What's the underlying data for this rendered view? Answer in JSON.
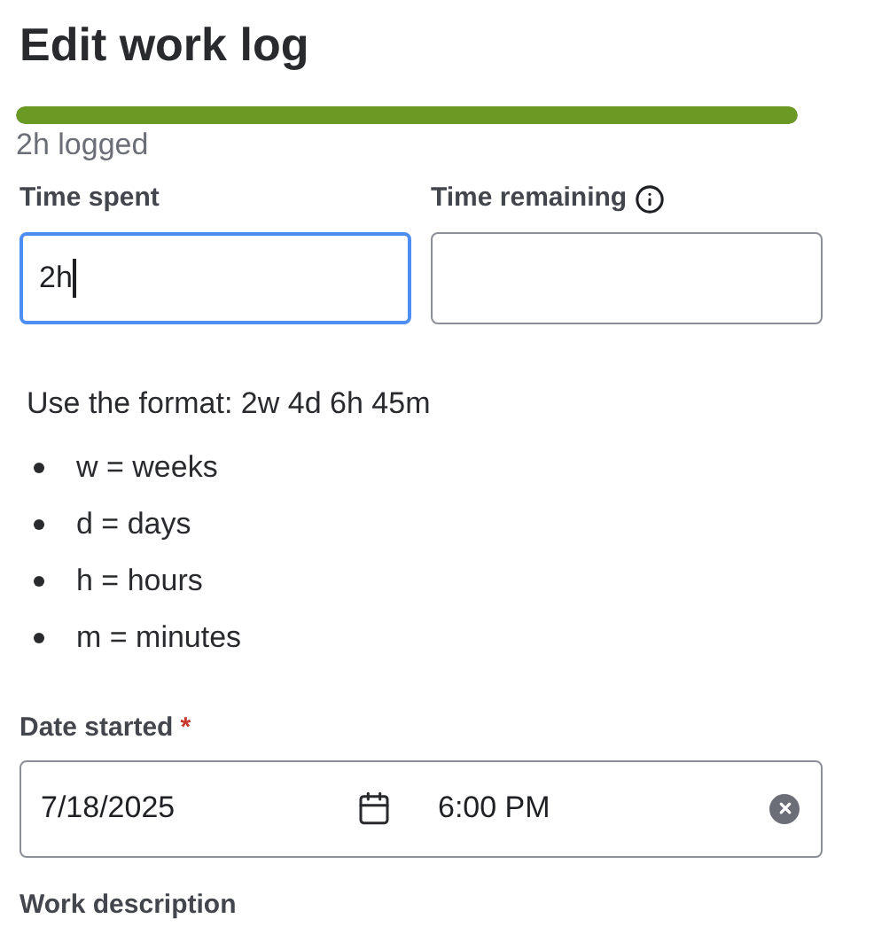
{
  "title": "Edit work log",
  "progress": {
    "level": 1,
    "caption": "2h logged"
  },
  "time_spent": {
    "label": "Time spent",
    "value": "2h",
    "focused": true
  },
  "time_remaining": {
    "label": "Time remaining",
    "focused": false
  },
  "format_help": {
    "text": "Use the format: 2w 4d 6h 45m",
    "items": [
      "w = weeks",
      "d = days",
      "h = hours",
      "m = minutes"
    ]
  },
  "date_started": {
    "label": "Date started",
    "required": true,
    "required_mark": "*",
    "date": "7/18/2025",
    "time": "6:00 PM"
  },
  "work_description": {
    "label": "Work description"
  }
}
